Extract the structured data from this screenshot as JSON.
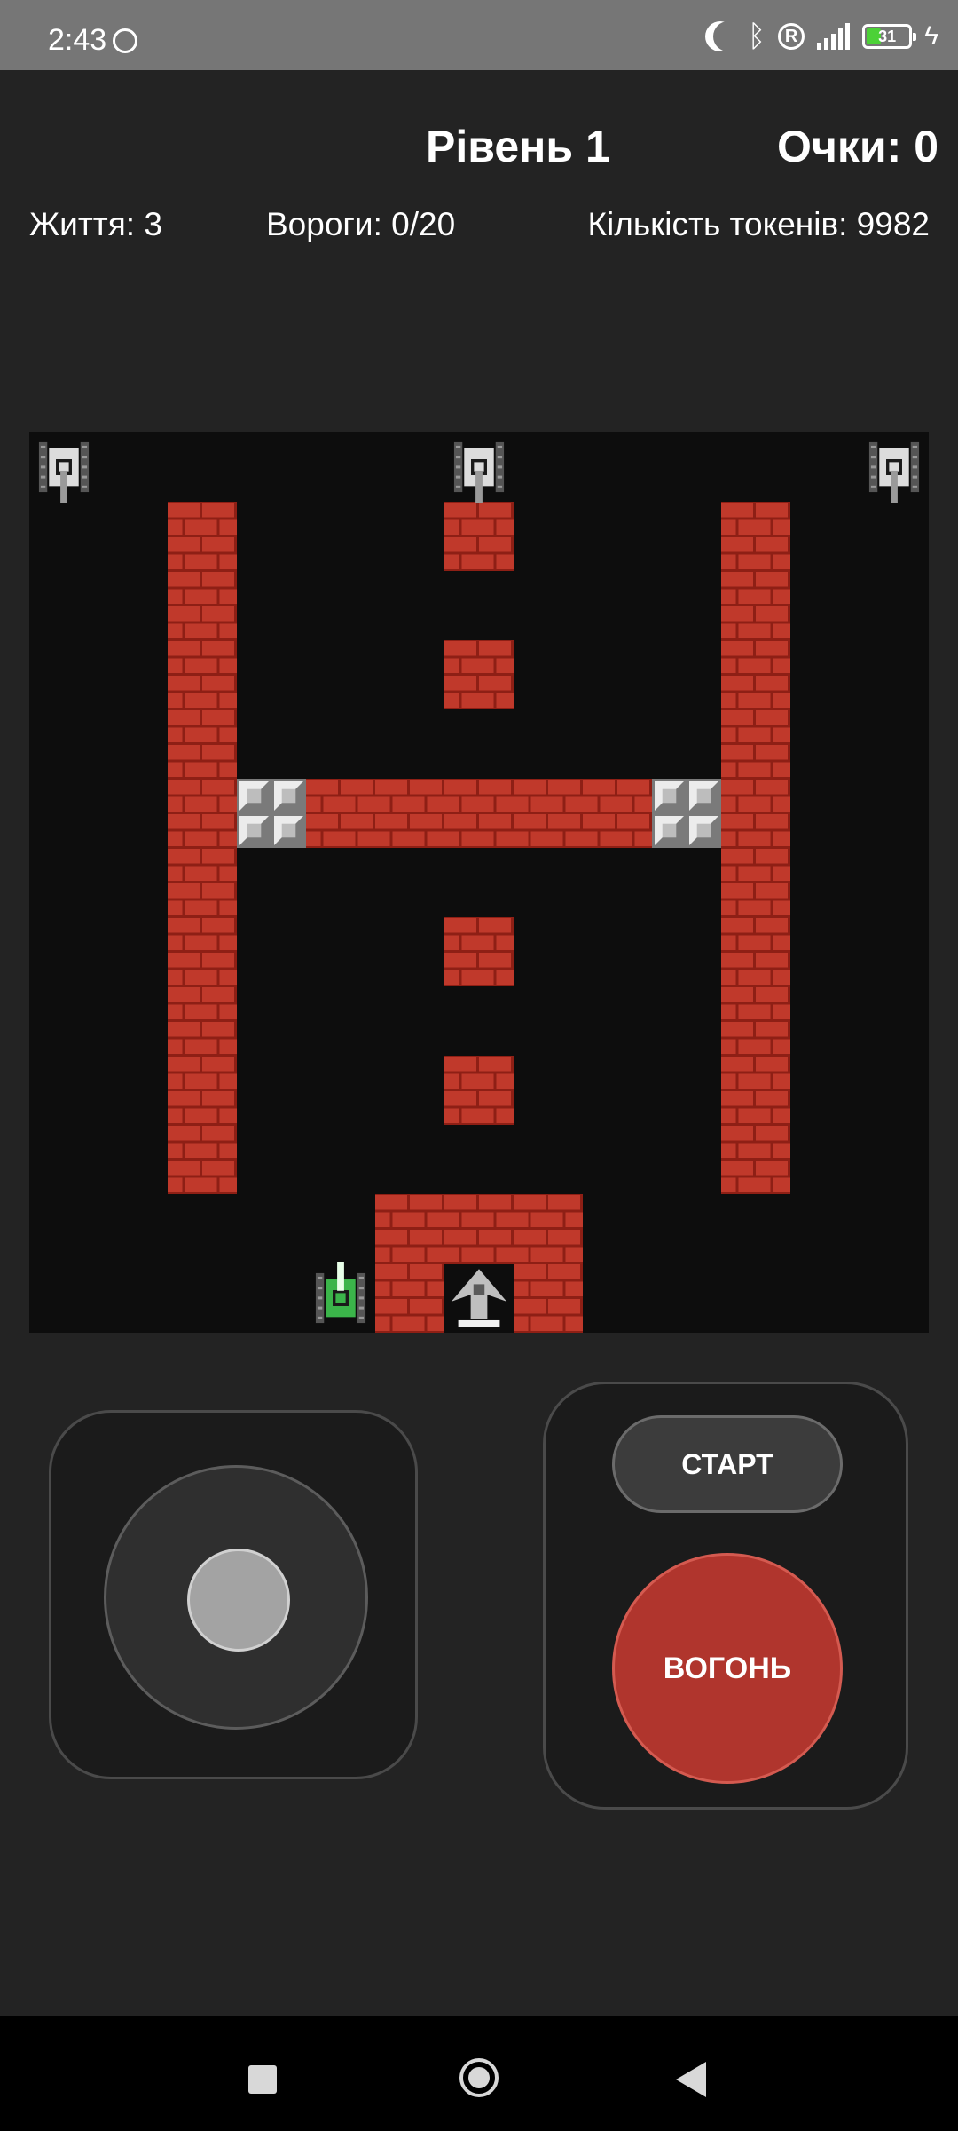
{
  "status_bar": {
    "time": "2:43",
    "battery": "31",
    "icons": [
      "whatsapp-icon",
      "moon-icon",
      "bluetooth-icon",
      "registered-icon",
      "signal-icon",
      "battery-icon",
      "charging-icon"
    ]
  },
  "hud": {
    "level": "Рівень 1",
    "score": "Очки: 0",
    "lives": "Життя: 3",
    "enemies": "Вороги: 0/20",
    "tokens": "Кількість токенів: 9982"
  },
  "game": {
    "grid_size": 13,
    "colors": {
      "background": "#0d0d0d",
      "brick": "#c0392b",
      "brick_mortar": "#8e1f15",
      "steel": "#bdbdbd",
      "player_tank": "#3bb54a",
      "enemy_tank": "#dcdcdc",
      "base": "#bfbfbf"
    },
    "brick_cells": [
      [
        2,
        1
      ],
      [
        2,
        2
      ],
      [
        2,
        3
      ],
      [
        2,
        4
      ],
      [
        2,
        5
      ],
      [
        2,
        6
      ],
      [
        2,
        7
      ],
      [
        2,
        8
      ],
      [
        2,
        9
      ],
      [
        2,
        10
      ],
      [
        10,
        1
      ],
      [
        10,
        2
      ],
      [
        10,
        3
      ],
      [
        10,
        4
      ],
      [
        10,
        5
      ],
      [
        10,
        6
      ],
      [
        10,
        7
      ],
      [
        10,
        8
      ],
      [
        10,
        9
      ],
      [
        10,
        10
      ],
      [
        6,
        1
      ],
      [
        6,
        3
      ],
      [
        6,
        7
      ],
      [
        6,
        9
      ],
      [
        4,
        5
      ],
      [
        5,
        5
      ],
      [
        6,
        5
      ],
      [
        7,
        5
      ],
      [
        8,
        5
      ],
      [
        5,
        11
      ],
      [
        6,
        11
      ],
      [
        7,
        11
      ],
      [
        5,
        12
      ],
      [
        7,
        12
      ]
    ],
    "steel_cells": [
      [
        3,
        5
      ],
      [
        9,
        5
      ]
    ],
    "enemies": [
      {
        "col": 0,
        "row": 0,
        "dir": "down"
      },
      {
        "col": 6,
        "row": 0,
        "dir": "down"
      },
      {
        "col": 12,
        "row": 0,
        "dir": "down"
      }
    ],
    "player": {
      "col": 4,
      "row": 12,
      "dir": "up"
    },
    "base": {
      "col": 6,
      "row": 12
    }
  },
  "controls": {
    "start_label": "СТАРТ",
    "fire_label": "ВОГОНЬ"
  },
  "nav": {
    "icons": [
      "recents-square-icon",
      "home-circle-icon",
      "back-triangle-icon"
    ]
  }
}
